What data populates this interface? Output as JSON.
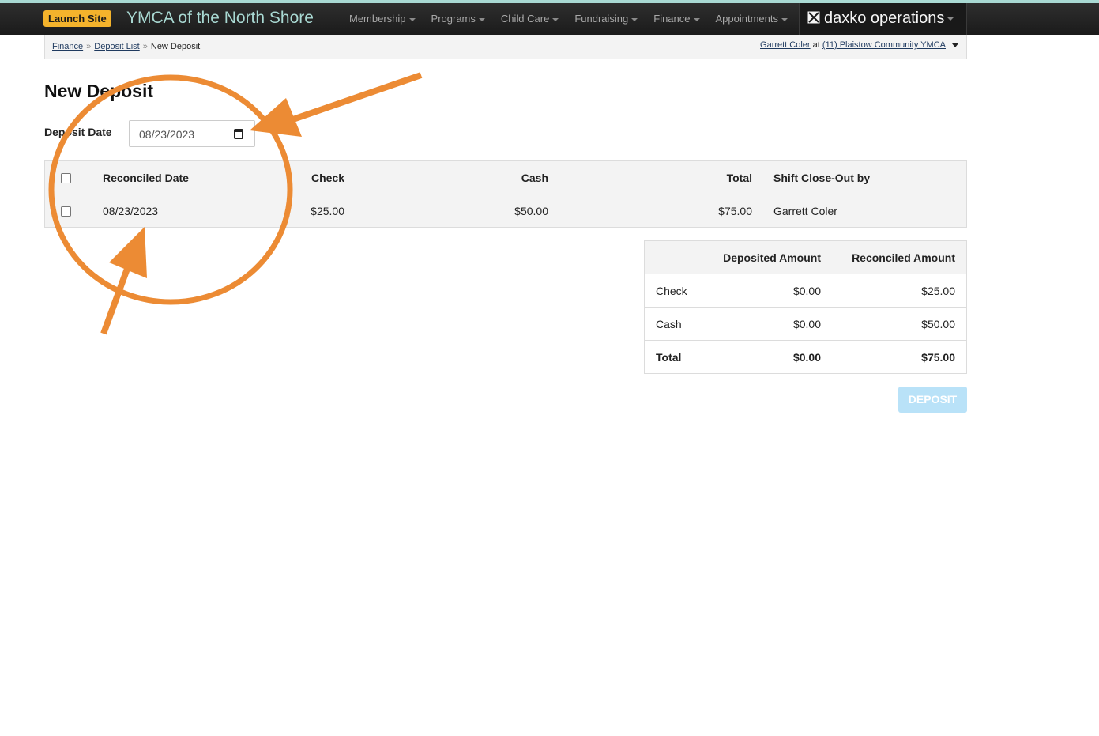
{
  "navbar": {
    "launch_label": "Launch Site",
    "brand": "YMCA of the North Shore",
    "menu": [
      "Membership",
      "Programs",
      "Child Care",
      "Fundraising",
      "Finance",
      "Appointments"
    ],
    "product": "daxko operations"
  },
  "breadcrumb": {
    "items": [
      "Finance",
      "Deposit List"
    ],
    "current": "New Deposit"
  },
  "user": {
    "name": "Garrett Coler",
    "at": "at",
    "location": "(11) Plaistow Community YMCA"
  },
  "page": {
    "title": "New Deposit",
    "date_label": "Deposit Date",
    "date_value": "08/23/2023"
  },
  "shifts_table": {
    "headers": [
      "Reconciled Date",
      "Check",
      "Cash",
      "Total",
      "Shift Close-Out by"
    ],
    "rows": [
      [
        "08/23/2023",
        "$25.00",
        "$50.00",
        "$75.00",
        "Garrett Coler"
      ]
    ]
  },
  "summary_table": {
    "headers": [
      "",
      "Deposited Amount",
      "Reconciled Amount"
    ],
    "rows": [
      [
        "Check",
        "$0.00",
        "$25.00"
      ],
      [
        "Cash",
        "$0.00",
        "$50.00"
      ],
      [
        "Total",
        "$0.00",
        "$75.00"
      ]
    ]
  },
  "deposit_button": "DEPOSIT",
  "colors": {
    "accent": "#a9d9d3",
    "launch": "#f4b32c",
    "annotation": "#ec8b34",
    "deposit_disabled": "#b9e2f8"
  }
}
